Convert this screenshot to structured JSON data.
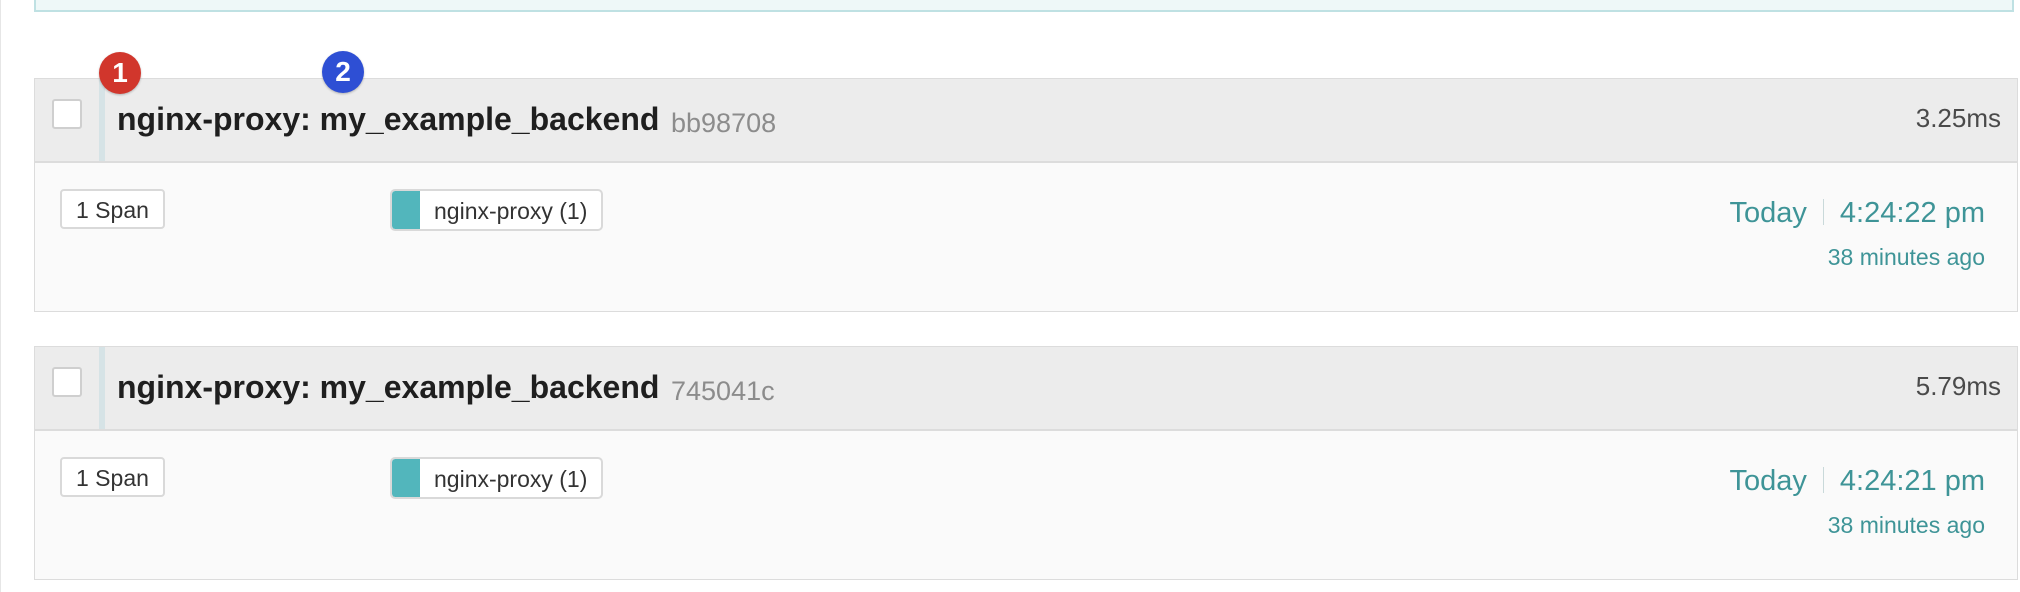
{
  "colors": {
    "accent": "#3e9497",
    "service_swatch": "#52b6bc",
    "marker_1": "#d1362c",
    "marker_2": "#2e4fd4"
  },
  "markers": [
    {
      "label": "1"
    },
    {
      "label": "2"
    }
  ],
  "traces": [
    {
      "title": "nginx-proxy: my_example_backend",
      "trace_id": "bb98708",
      "duration": "3.25ms",
      "span_count": "1 Span",
      "service": "nginx-proxy (1)",
      "date": "Today",
      "time": "4:24:22 pm",
      "ago": "38 minutes ago"
    },
    {
      "title": "nginx-proxy: my_example_backend",
      "trace_id": "745041c",
      "duration": "5.79ms",
      "span_count": "1 Span",
      "service": "nginx-proxy (1)",
      "date": "Today",
      "time": "4:24:21 pm",
      "ago": "38 minutes ago"
    }
  ]
}
